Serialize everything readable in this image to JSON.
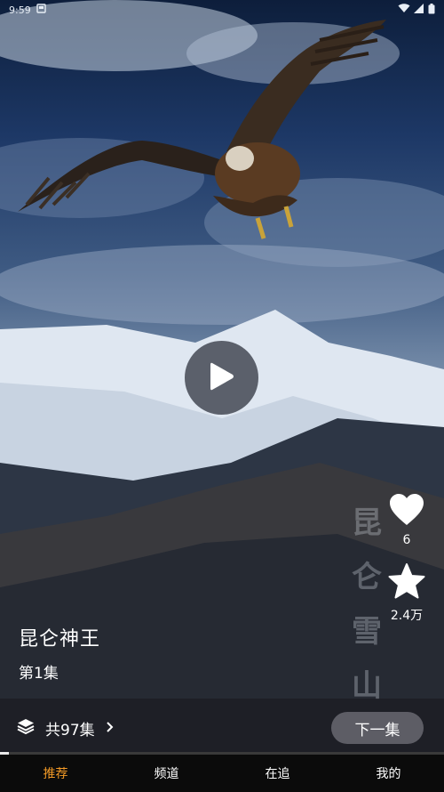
{
  "status_bar": {
    "time": "9:59"
  },
  "player": {
    "likes": "6",
    "favorites": "2.4万",
    "watermark_chars": [
      "昆",
      "仑",
      "雪",
      "山"
    ],
    "progress_fraction": 0.02
  },
  "show": {
    "title": "昆仑神王",
    "episode": "第1集"
  },
  "collection": {
    "label": "共97集"
  },
  "next_button": {
    "label": "下一集"
  },
  "bottom_nav": {
    "items": [
      {
        "label": "推荐",
        "active": true
      },
      {
        "label": "频道",
        "active": false
      },
      {
        "label": "在追",
        "active": false
      },
      {
        "label": "我的",
        "active": false
      }
    ]
  },
  "colors": {
    "accent": "#f39a26"
  }
}
